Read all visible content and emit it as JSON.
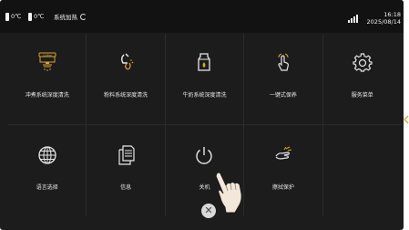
{
  "status_bar": {
    "temp1": "0℃",
    "temp2": "0℃",
    "system_status": "系统加热",
    "time": "16:18",
    "date": "2025/08/14"
  },
  "menu": {
    "tiles": [
      {
        "label": "冲煮系统深度清洗",
        "icon": "coffee-machine-icon"
      },
      {
        "label": "粉料系统深度清洗",
        "icon": "powder-cleaning-icon"
      },
      {
        "label": "牛奶系统深度清洗",
        "icon": "milk-carton-icon"
      },
      {
        "label": "一键式保养",
        "icon": "tap-hand-icon"
      },
      {
        "label": "服务菜单",
        "icon": "gear-icon"
      },
      {
        "label": "语言选择",
        "icon": "globe-icon"
      },
      {
        "label": "信息",
        "icon": "document-icon"
      },
      {
        "label": "关机",
        "icon": "power-icon"
      },
      {
        "label": "擦拭保护",
        "icon": "wipe-hand-icon"
      }
    ]
  },
  "close_symbol": "✕",
  "colors": {
    "background": "#1c1c1c",
    "status_bar": "#121212",
    "accent_gold": "#d9a62e",
    "icon": "#e8e8e8"
  }
}
